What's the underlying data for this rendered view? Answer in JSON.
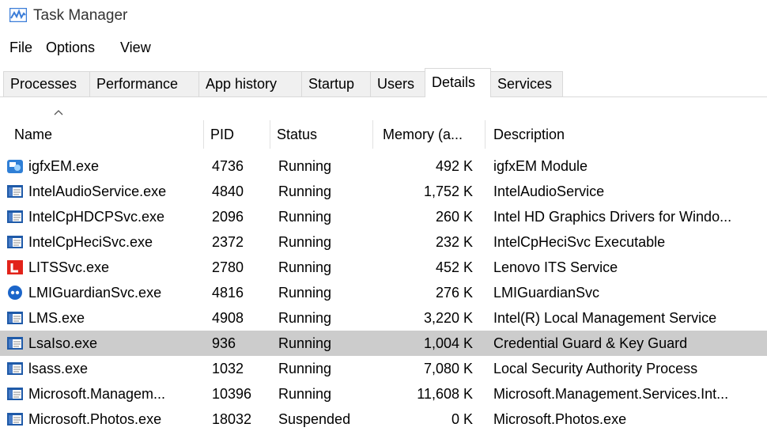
{
  "window": {
    "title": "Task Manager",
    "icon": "task-manager-icon"
  },
  "menu": [
    "File",
    "Options",
    "View"
  ],
  "tabs": [
    "Processes",
    "Performance",
    "App history",
    "Startup",
    "Users",
    "Details",
    "Services"
  ],
  "active_tab": "Details",
  "columns": [
    "Name",
    "PID",
    "Status",
    "Memory (a...",
    "Description"
  ],
  "selected_row": 7,
  "rows": [
    {
      "icon": "igfx-icon",
      "name": "igfxEM.exe",
      "pid": "4736",
      "status": "Running",
      "memory": "492 K",
      "description": "igfxEM Module"
    },
    {
      "icon": "window-app-icon",
      "name": "IntelAudioService.exe",
      "pid": "4840",
      "status": "Running",
      "memory": "1,752 K",
      "description": "IntelAudioService"
    },
    {
      "icon": "window-app-icon",
      "name": "IntelCpHDCPSvc.exe",
      "pid": "2096",
      "status": "Running",
      "memory": "260 K",
      "description": "Intel HD Graphics Drivers for Windo..."
    },
    {
      "icon": "window-app-icon",
      "name": "IntelCpHeciSvc.exe",
      "pid": "2372",
      "status": "Running",
      "memory": "232 K",
      "description": "IntelCpHeciSvc Executable"
    },
    {
      "icon": "lenovo-l-icon",
      "name": "LITSSvc.exe",
      "pid": "2780",
      "status": "Running",
      "memory": "452 K",
      "description": "Lenovo ITS Service"
    },
    {
      "icon": "logmein-icon",
      "name": "LMIGuardianSvc.exe",
      "pid": "4816",
      "status": "Running",
      "memory": "276 K",
      "description": "LMIGuardianSvc"
    },
    {
      "icon": "window-app-icon",
      "name": "LMS.exe",
      "pid": "4908",
      "status": "Running",
      "memory": "3,220 K",
      "description": "Intel(R) Local Management Service"
    },
    {
      "icon": "window-app-icon",
      "name": "LsaIso.exe",
      "pid": "936",
      "status": "Running",
      "memory": "1,004 K",
      "description": "Credential Guard & Key Guard"
    },
    {
      "icon": "window-app-icon",
      "name": "lsass.exe",
      "pid": "1032",
      "status": "Running",
      "memory": "7,080 K",
      "description": "Local Security Authority Process"
    },
    {
      "icon": "window-app-icon",
      "name": "Microsoft.Managem...",
      "pid": "10396",
      "status": "Running",
      "memory": "11,608 K",
      "description": "Microsoft.Management.Services.Int..."
    },
    {
      "icon": "window-app-icon",
      "name": "Microsoft.Photos.exe",
      "pid": "18032",
      "status": "Suspended",
      "memory": "0 K",
      "description": "Microsoft.Photos.exe"
    }
  ],
  "colors": {
    "selected_row": "#cccccc",
    "tab_bg": "#f0f0f0",
    "border": "#d9d9d9"
  }
}
